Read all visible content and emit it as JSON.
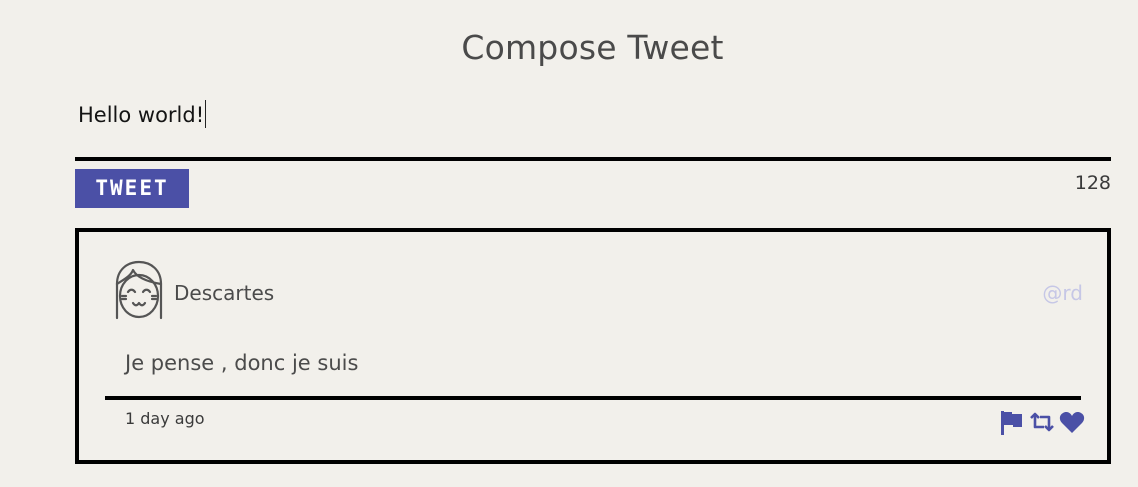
{
  "page": {
    "title": "Compose Tweet"
  },
  "compose": {
    "value": "Hello world!",
    "button_label": "TWEET",
    "remaining_chars": "128"
  },
  "colors": {
    "background": "#f2f0eb",
    "accent": "#4b50a6",
    "handle": "#c6c7e6",
    "border": "#000000"
  },
  "tweets": [
    {
      "author": "Descartes",
      "handle": "@rd",
      "text": "Je pense , donc je suis",
      "time": "1 day ago",
      "avatar_icon": "girl-face-avatar-icon",
      "actions": [
        "flag-icon",
        "retweet-icon",
        "heart-icon"
      ]
    }
  ]
}
